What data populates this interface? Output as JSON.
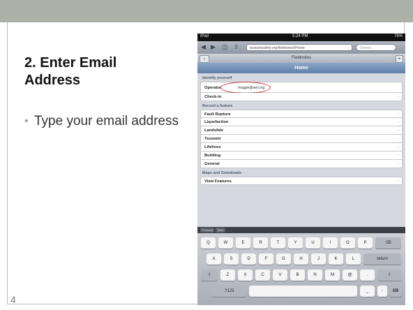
{
  "slide": {
    "title": "2. Enter Email Address",
    "bullet": "Type your email address",
    "bullet_marker": "•",
    "page_number": "4",
    "colors": {
      "top_band": "#abb1a7",
      "highlight": "#c4372f"
    }
  },
  "ipad": {
    "status": {
      "device": "iPad",
      "time": "5:24 PM",
      "battery": "76%"
    },
    "browser": {
      "url": "tsunamisafety.org/fieldnotes/iPhone",
      "search_placeholder": "Search",
      "page_title": "Fieldnotes",
      "back_glyph": "◀",
      "forward_glyph": "▶",
      "plus_glyph": "+"
    },
    "home_title": "Home",
    "sections": [
      {
        "heading": "Identify yourself",
        "rows": [
          {
            "label": "Operator",
            "value": "maggie@eeri.org"
          },
          {
            "label": "Check-in",
            "value": ""
          }
        ]
      },
      {
        "heading": "Record a feature",
        "rows": [
          {
            "label": "Fault Rupture"
          },
          {
            "label": "Liquefaction"
          },
          {
            "label": "Landslide"
          },
          {
            "label": "Tsunami"
          },
          {
            "label": "Lifelines"
          },
          {
            "label": "Building"
          },
          {
            "label": "General"
          }
        ]
      },
      {
        "heading": "Maps and Downloads",
        "rows": [
          {
            "label": "View Features"
          }
        ]
      }
    ],
    "chevron": "›",
    "keyboard": {
      "toolbar": [
        "Previous",
        "Next"
      ],
      "row1": [
        "Q",
        "W",
        "E",
        "R",
        "T",
        "Y",
        "U",
        "I",
        "O",
        "P",
        "⌫"
      ],
      "row2": [
        "A",
        "S",
        "D",
        "F",
        "G",
        "H",
        "J",
        "K",
        "L",
        "return"
      ],
      "row3": [
        "⇧",
        "Z",
        "X",
        "C",
        "V",
        "B",
        "N",
        "M",
        "@",
        ".",
        "⇧"
      ],
      "row4": [
        ".?123",
        "",
        "_",
        "-",
        "⌨"
      ]
    }
  }
}
